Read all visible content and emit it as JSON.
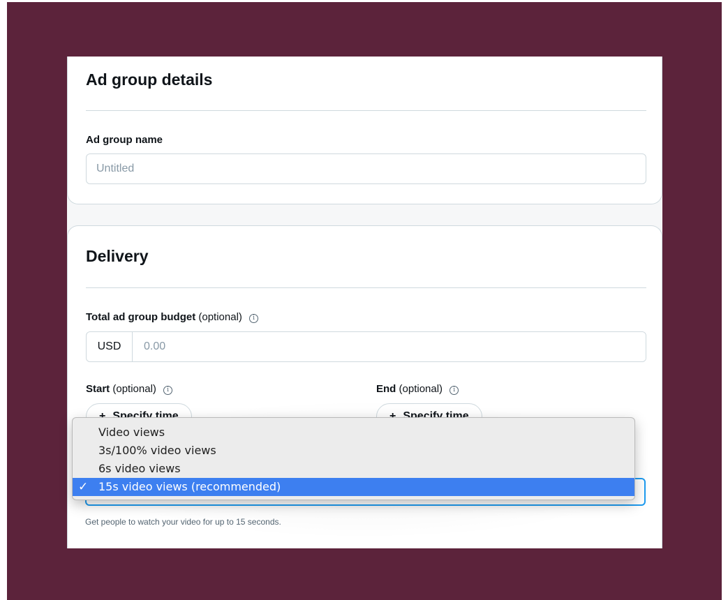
{
  "details": {
    "title": "Ad group details",
    "name_label": "Ad group name",
    "name_placeholder": "Untitled"
  },
  "delivery": {
    "title": "Delivery",
    "budget_label": "Total ad group budget",
    "budget_optional": "(optional)",
    "currency": "USD",
    "budget_placeholder": "0.00",
    "start_label": "Start",
    "start_optional": "(optional)",
    "end_label": "End",
    "end_optional": "(optional)",
    "specify_time_label": "Specify time",
    "specify_time_icon": "plus-icon",
    "info_icon": "info-icon"
  },
  "optimization": {
    "selected_value": "15s video views (recommended)",
    "helper_text": "Get people to watch your video for up to 15 seconds.",
    "options": [
      {
        "label": "Video views",
        "selected": false
      },
      {
        "label": "3s/100% video views",
        "selected": false
      },
      {
        "label": "6s video views",
        "selected": false
      },
      {
        "label": "15s video views (recommended)",
        "selected": true
      }
    ]
  },
  "colors": {
    "background": "#5c233b",
    "accent": "#1d9bf0",
    "selected_option": "#3d7ff0"
  }
}
